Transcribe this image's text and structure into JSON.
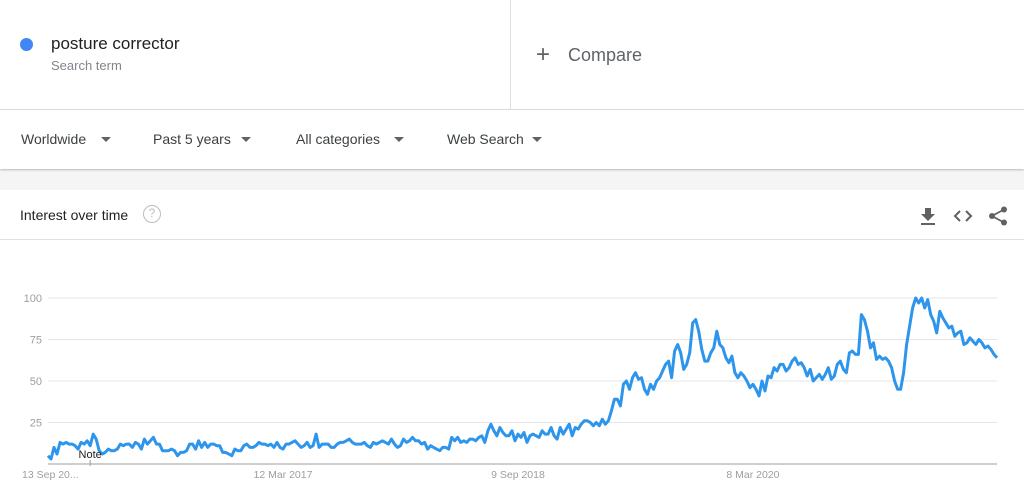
{
  "search_term": {
    "name": "posture corrector",
    "subtitle": "Search term",
    "color": "#4285f4"
  },
  "compare": {
    "label": "Compare",
    "icon": "plus-icon"
  },
  "filters": [
    {
      "label": "Worldwide"
    },
    {
      "label": "Past 5 years"
    },
    {
      "label": "All categories"
    },
    {
      "label": "Web Search"
    }
  ],
  "card": {
    "title": "Interest over time",
    "help_icon": "?",
    "actions": [
      "download-icon",
      "embed-icon",
      "share-icon"
    ]
  },
  "chart_data": {
    "type": "line",
    "title": "Interest over time",
    "xlabel": "",
    "ylabel": "",
    "ylim": [
      0,
      100
    ],
    "yticks": [
      25,
      50,
      75,
      100
    ],
    "xtick_labels": [
      "13 Sep 20...",
      "12 Mar 2017",
      "9 Sep 2018",
      "8 Mar 2020"
    ],
    "xtick_positions": [
      0,
      78,
      156,
      234
    ],
    "annotation": {
      "label": "Note",
      "index": 14
    },
    "grid": true,
    "legend": "none",
    "color": "#2d95eb",
    "series": [
      {
        "name": "posture corrector",
        "values": [
          5,
          3,
          10,
          6,
          13,
          12,
          13,
          12,
          12,
          11,
          9,
          13,
          12,
          14,
          11,
          18,
          15,
          8,
          6,
          7,
          9,
          8,
          8,
          9,
          12,
          11,
          12,
          12,
          10,
          13,
          12,
          9,
          15,
          12,
          14,
          16,
          12,
          12,
          8,
          8,
          8,
          9,
          8,
          5,
          7,
          7,
          8,
          12,
          12,
          9,
          14,
          10,
          13,
          10,
          12,
          12,
          11,
          11,
          7,
          7,
          6,
          5,
          9,
          8,
          8,
          11,
          12,
          10,
          10,
          11,
          13,
          12,
          12,
          11,
          12,
          10,
          13,
          10,
          9,
          12,
          12,
          13,
          14,
          12,
          10,
          11,
          13,
          10,
          11,
          18,
          10,
          12,
          12,
          12,
          10,
          10,
          12,
          13,
          13,
          14,
          15,
          13,
          12,
          12,
          12,
          13,
          11,
          10,
          13,
          12,
          13,
          14,
          13,
          12,
          15,
          12,
          10,
          11,
          15,
          13,
          14,
          16,
          14,
          14,
          12,
          13,
          9,
          11,
          10,
          9,
          8,
          10,
          10,
          9,
          16,
          14,
          16,
          13,
          14,
          13,
          15,
          15,
          14,
          16,
          17,
          13,
          20,
          24,
          20,
          17,
          22,
          19,
          17,
          17,
          20,
          14,
          18,
          16,
          19,
          13,
          17,
          18,
          17,
          16,
          20,
          18,
          18,
          22,
          17,
          15,
          22,
          18,
          21,
          24,
          17,
          22,
          21,
          24,
          26,
          26,
          25,
          23,
          25,
          23,
          27,
          24,
          26,
          32,
          39,
          39,
          35,
          48,
          50,
          45,
          52,
          55,
          51,
          52,
          45,
          42,
          48,
          45,
          50,
          52,
          56,
          60,
          62,
          52,
          68,
          72,
          67,
          57,
          60,
          67,
          85,
          87,
          80,
          69,
          62,
          62,
          67,
          70,
          80,
          72,
          70,
          64,
          61,
          65,
          55,
          52,
          55,
          53,
          50,
          46,
          48,
          45,
          41,
          50,
          44,
          53,
          52,
          58,
          56,
          60,
          60,
          56,
          58,
          62,
          64,
          60,
          61,
          58,
          53,
          57,
          50,
          52,
          54,
          51,
          54,
          58,
          51,
          53,
          60,
          62,
          57,
          55,
          67,
          68,
          66,
          66,
          90,
          87,
          80,
          70,
          73,
          63,
          65,
          63,
          64,
          62,
          58,
          50,
          45,
          45,
          55,
          72,
          83,
          94,
          100,
          97,
          100,
          94,
          99,
          90,
          86,
          79,
          92,
          88,
          85,
          82,
          83,
          77,
          79,
          80,
          72,
          73,
          76,
          74,
          72,
          75,
          73,
          70,
          71,
          69,
          66,
          64
        ]
      }
    ]
  }
}
